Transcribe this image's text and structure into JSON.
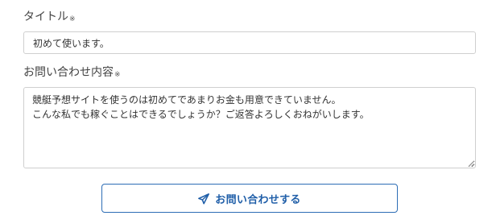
{
  "form": {
    "title_field": {
      "label": "タイトル",
      "required_mark": "※",
      "value": "初めて使います。"
    },
    "content_field": {
      "label": "お問い合わせ内容",
      "required_mark": "※",
      "value": "競艇予想サイトを使うのは初めてであまりお金も用意できていません。\nこんな私でも稼ぐことはできるでしょうか？ご返答よろしくおねがいします。"
    },
    "submit": {
      "label": "お問い合わせする",
      "icon": "paper-plane-icon",
      "color": "#1f5ea8",
      "border_color": "#2d6db5"
    }
  }
}
